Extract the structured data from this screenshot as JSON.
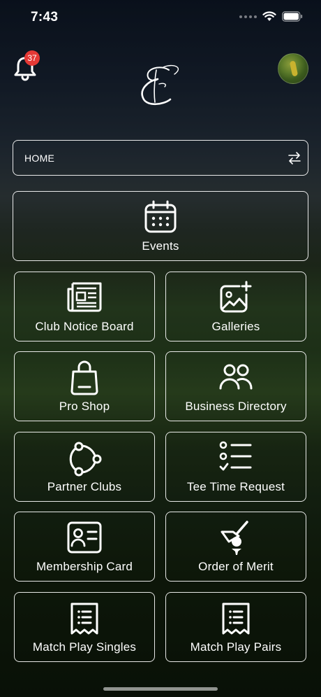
{
  "status_bar": {
    "time": "7:43"
  },
  "header": {
    "notification_count": "37",
    "logo_letter": "E"
  },
  "selector": {
    "label": "HOME"
  },
  "events_tile": {
    "label": "Events",
    "icon": "calendar-icon"
  },
  "tiles": [
    {
      "label": "Club Notice Board",
      "icon": "newspaper-icon"
    },
    {
      "label": "Galleries",
      "icon": "gallery-add-icon"
    },
    {
      "label": "Pro Shop",
      "icon": "shopping-bag-icon"
    },
    {
      "label": "Business Directory",
      "icon": "people-icon"
    },
    {
      "label": "Partner Clubs",
      "icon": "network-icon"
    },
    {
      "label": "Tee Time Request",
      "icon": "checklist-icon"
    },
    {
      "label": "Membership Card",
      "icon": "id-card-icon"
    },
    {
      "label": "Order of Merit",
      "icon": "golf-tee-icon"
    },
    {
      "label": "Match Play Singles",
      "icon": "receipt-icon"
    },
    {
      "label": "Match Play Pairs",
      "icon": "receipt-icon"
    }
  ]
}
